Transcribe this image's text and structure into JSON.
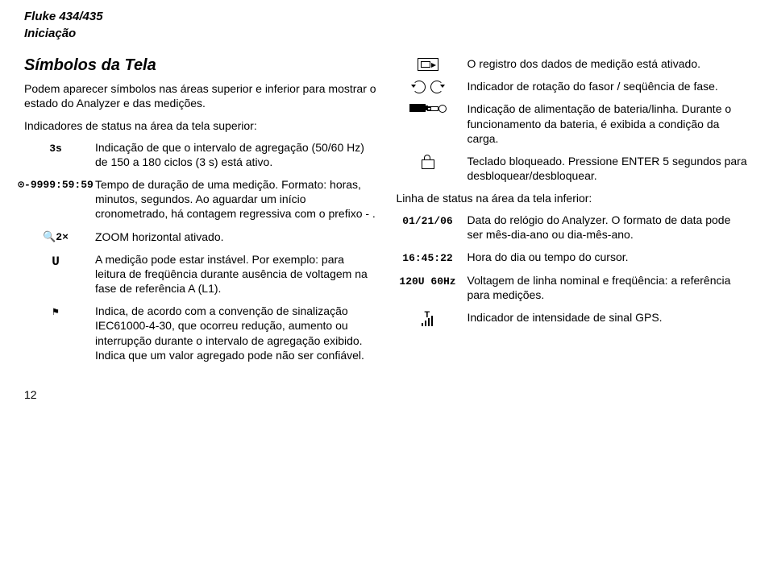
{
  "header": {
    "product": "Fluke 434/435",
    "subtitle": "Iniciação"
  },
  "section_title": "Símbolos da Tela",
  "intro": "Podem aparecer símbolos nas áreas superior e inferior para mostrar o estado do Analyzer e das medições.",
  "subhead_top": "Indicadores de status na área da tela superior:",
  "left": {
    "r1": {
      "sym": "3s",
      "desc": "Indicação de que o intervalo de agregação (50/60 Hz) de 150 a 180 ciclos (3 s) está ativo."
    },
    "r2": {
      "sym": "⊙-9999:59:59",
      "desc": "Tempo de duração de uma medição. Formato: horas, minutos, segundos. Ao aguardar um início cronometrado, há contagem regressiva com o prefixo - ."
    },
    "r3": {
      "sym": "🔍2×",
      "desc": "ZOOM horizontal ativado."
    },
    "r4": {
      "sym": "U",
      "desc": "A medição pode estar instável. Por exemplo: para leitura de freqüência durante ausência de voltagem na fase de referência A (L1)."
    },
    "r5": {
      "sym": "⚑",
      "desc": "Indica, de acordo com a convenção de sinalização IEC61000-4-30, que ocorreu redução, aumento ou interrupção durante o intervalo de agregação exibido. Indica que um valor agregado pode não ser confiável."
    }
  },
  "right": {
    "r1": {
      "desc": "O registro dos dados de medição está ativado."
    },
    "r2": {
      "desc": "Indicador de rotação do fasor / seqüência de fase."
    },
    "r3": {
      "desc": "Indicação de alimentação de bateria/linha. Durante o funcionamento da bateria, é exibida a condição da carga."
    },
    "r4": {
      "desc": "Teclado bloqueado. Pressione ENTER 5 segundos para desbloquear/desbloquear."
    }
  },
  "subhead_bottom": "Linha de status na área da tela inferior:",
  "bottom": {
    "r1": {
      "sym": "01/21/06",
      "desc": "Data do relógio do Analyzer. O formato de data pode ser mês-dia-ano ou dia-mês-ano."
    },
    "r2": {
      "sym": "16:45:22",
      "desc": "Hora do dia ou tempo do cursor."
    },
    "r3": {
      "sym": "120U  60Hz",
      "desc": "Voltagem de linha nominal e freqüência: a referência para medições."
    },
    "r4": {
      "desc": "Indicador de intensidade de sinal GPS."
    }
  },
  "page_number": "12"
}
